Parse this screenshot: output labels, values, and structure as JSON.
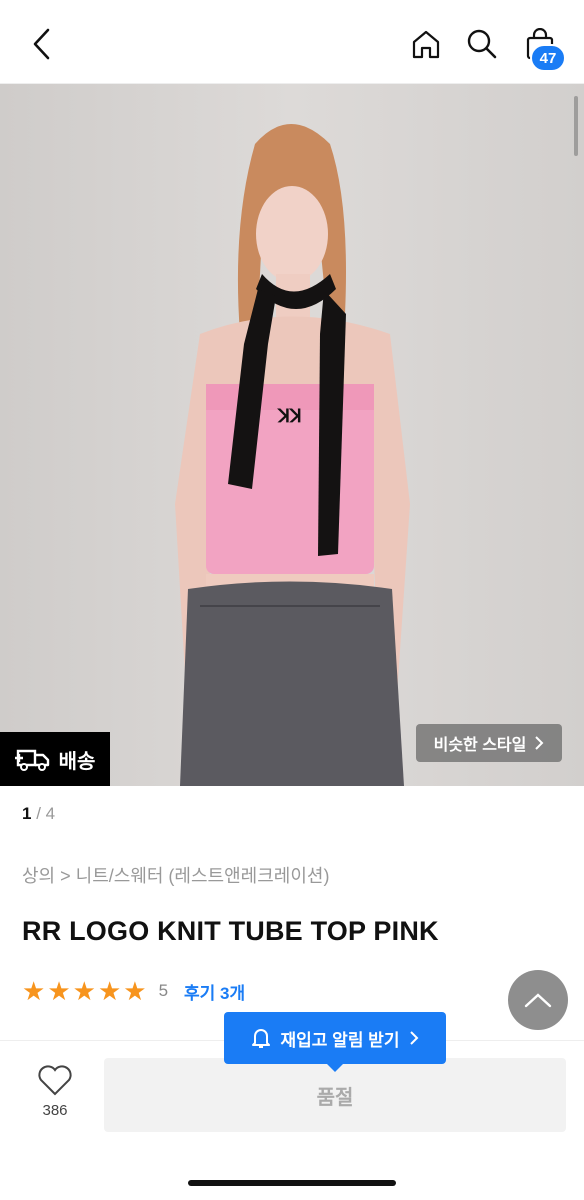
{
  "header": {
    "back_icon": "chevron-left-icon",
    "home_icon": "home-icon",
    "search_icon": "search-icon",
    "cart_icon": "shopping-bag-icon",
    "cart_count": "47"
  },
  "gallery": {
    "image_alt": "model wearing pink knit tube top with black scarf and grey jeans",
    "delivery_label": "배송",
    "similar_style_label": "비슷한 스타일",
    "page_current": "1",
    "page_separator": "/",
    "page_total": "4"
  },
  "product": {
    "breadcrumb": "상의 > 니트/스웨터 (레스트앤레크레이션)",
    "title": "RR LOGO KNIT TUBE TOP PINK",
    "rating_stars": 5,
    "rating_count": "5",
    "reviews_link": "후기 3개"
  },
  "bottom": {
    "like_count": "386",
    "soldout_label": "품절",
    "restock_label": "재입고 알림 받기"
  },
  "colors": {
    "accent": "#1a7cf5",
    "star": "#f7941d",
    "soldout_bg": "#f2f2f2"
  }
}
